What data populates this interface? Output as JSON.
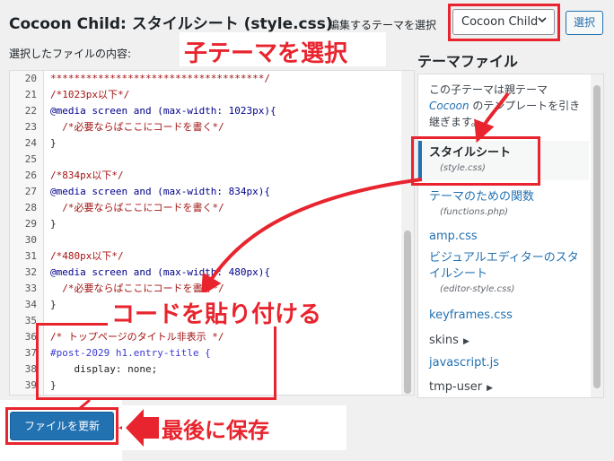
{
  "header": {
    "title": "Cocoon Child: スタイルシート (style.css)",
    "select_label": "編集するテーマを選択",
    "selected_theme": "Cocoon Child",
    "select_button": "選択"
  },
  "editor": {
    "label": "選択したファイルの内容:",
    "lines": [
      {
        "num": "20",
        "text": "************************************/"
      },
      {
        "num": "21",
        "text": "/*1023px以下*/"
      },
      {
        "num": "22",
        "text": "@media screen and (max-width: 1023px){"
      },
      {
        "num": "23",
        "text": "  /*必要ならばここにコードを書く*/"
      },
      {
        "num": "24",
        "text": "}"
      },
      {
        "num": "25",
        "text": ""
      },
      {
        "num": "26",
        "text": "/*834px以下*/"
      },
      {
        "num": "27",
        "text": "@media screen and (max-width: 834px){"
      },
      {
        "num": "28",
        "text": "  /*必要ならばここにコードを書く*/"
      },
      {
        "num": "29",
        "text": "}"
      },
      {
        "num": "30",
        "text": ""
      },
      {
        "num": "31",
        "text": "/*480px以下*/"
      },
      {
        "num": "32",
        "text": "@media screen and (max-width: 480px){"
      },
      {
        "num": "33",
        "text": "  /*必要ならばここにコードを書く*/"
      },
      {
        "num": "34",
        "text": "}"
      },
      {
        "num": "35",
        "text": ""
      },
      {
        "num": "36",
        "text": "/* トップページのタイトル非表示 */"
      },
      {
        "num": "37",
        "text": "#post-2029 h1.entry-title {"
      },
      {
        "num": "38",
        "text": "    display: none;"
      },
      {
        "num": "39",
        "text": "}"
      }
    ]
  },
  "sidebar": {
    "heading": "テーマファイル",
    "note_before": "この子テーマは親テーマ ",
    "note_theme": "Cocoon",
    "note_after": " のテンプレートを引き継ぎます。",
    "files": [
      {
        "name": "スタイルシート",
        "file": "(style.css)"
      },
      {
        "name": "テーマのための関数",
        "file": "(functions.php)"
      },
      {
        "name": "amp.css",
        "file": ""
      },
      {
        "name": "ビジュアルエディターのスタイルシート",
        "file": "(editor-style.css)"
      },
      {
        "name": "keyframes.css",
        "file": ""
      },
      {
        "name": "skins",
        "file": ""
      },
      {
        "name": "javascript.js",
        "file": ""
      },
      {
        "name": "tmp-user",
        "file": ""
      }
    ]
  },
  "footer": {
    "update_button": "ファイルを更新"
  },
  "annotations": {
    "choose_child": "子テーマを選択",
    "paste_code": "コードを貼り付ける",
    "save_last": "最後に保存"
  },
  "colors": {
    "accent": "#2271b1",
    "annotation": "#e8242e"
  }
}
